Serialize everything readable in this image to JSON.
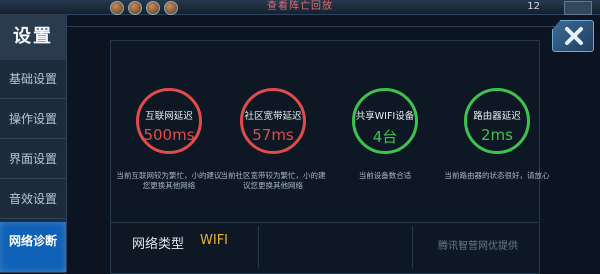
{
  "topbar": {
    "center_text": "查看阵亡回放",
    "right_text": "12"
  },
  "sidebar": {
    "title": "设置",
    "items": [
      {
        "label": "基础设置"
      },
      {
        "label": "操作设置"
      },
      {
        "label": "界面设置"
      },
      {
        "label": "音效设置"
      },
      {
        "label": "网络诊断"
      }
    ]
  },
  "stats": [
    {
      "label": "互联网延迟",
      "value": "500ms",
      "desc": "当前互联网较为繁忙，小的建议您更换其他网络",
      "color": "#e04b4b"
    },
    {
      "label": "社区宽带延迟",
      "value": "57ms",
      "desc": "当前社区宽带较为繁忙，小的建议您更换其他网络",
      "color": "#e04b4b"
    },
    {
      "label": "共享WIFI设备",
      "value": "4台",
      "desc": "当前设备数合适",
      "color": "#3dc24f"
    },
    {
      "label": "路由器延迟",
      "value": "2ms",
      "desc": "当前路由器的状态很好，请放心",
      "color": "#3dc24f"
    }
  ],
  "footer": {
    "network_type_label": "网络类型",
    "network_type_value": "WIFI",
    "provider": "腾讯智营网优提供"
  },
  "colors": {
    "accent": "#0f61b8",
    "bad": "#e04b4b",
    "good": "#3dc24f",
    "network_value": "#e8b23a"
  }
}
